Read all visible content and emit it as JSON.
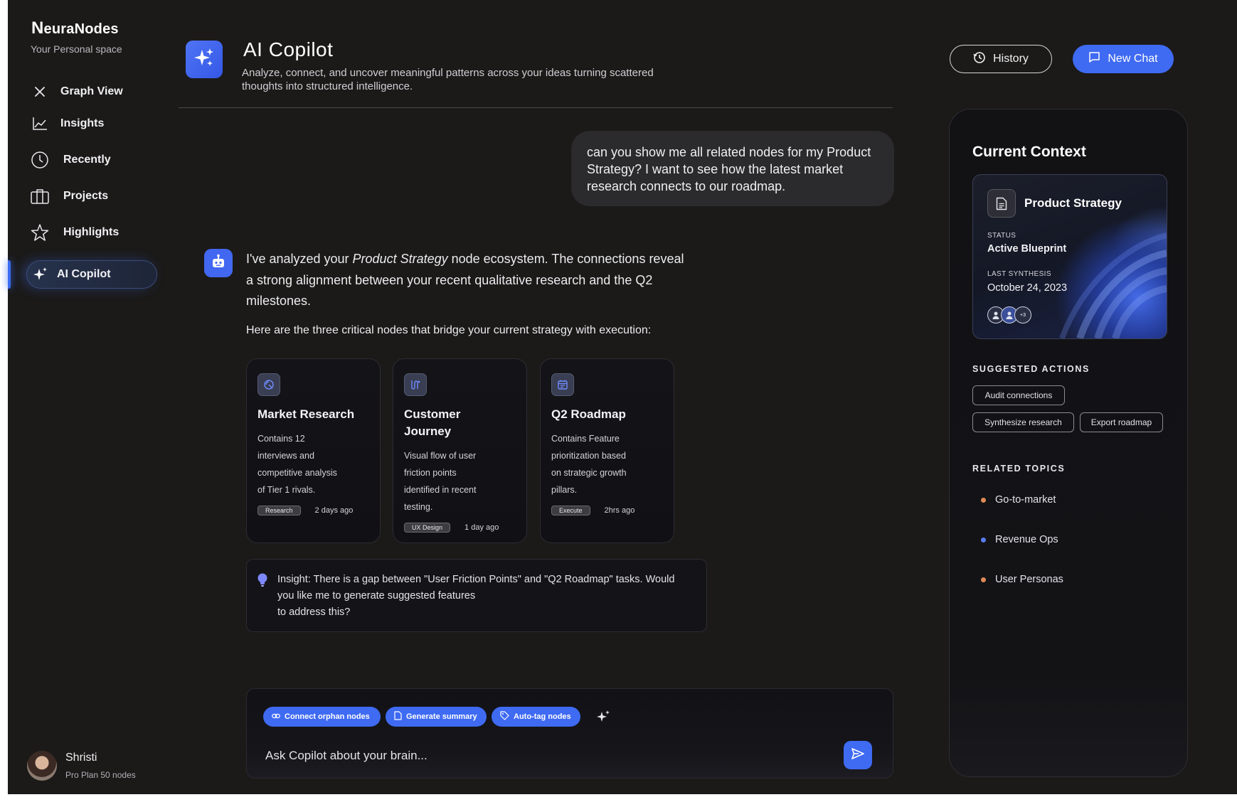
{
  "brand": {
    "logo_letter": "N",
    "logo_rest": "euraNodes",
    "subtitle": "Your Personal space"
  },
  "sidebar": {
    "items": [
      {
        "label": "Graph View",
        "icon": "graph-view-icon"
      },
      {
        "label": "Insights",
        "icon": "chart-line-icon"
      },
      {
        "label": "Recently",
        "icon": "clock-icon"
      },
      {
        "label": "Projects",
        "icon": "projects-icon"
      },
      {
        "label": "Highlights",
        "icon": "star-icon"
      },
      {
        "label": "AI Copilot",
        "icon": "sparkle-icon",
        "active": true
      }
    ]
  },
  "user": {
    "name": "Shristi",
    "plan": "Pro Plan 50 nodes"
  },
  "header": {
    "title": "AI Copilot",
    "description": "Analyze, connect, and uncover meaningful patterns across your ideas turning scattered thoughts into structured intelligence.",
    "history_label": "History",
    "new_chat_label": "New Chat"
  },
  "chat": {
    "user_message": "can you show me all related nodes for my Product Strategy? I want to see how the latest market research connects to our roadmap.",
    "bot_intro_before": "I've analyzed your ",
    "bot_intro_emph": "Product Strategy",
    "bot_intro_after": " node ecosystem. The connections reveal a strong alignment between your recent qualitative research and the Q2 milestones.",
    "bot_followup": "Here are the three critical nodes that bridge your current strategy with execution:",
    "nodes": [
      {
        "title": "Market Research",
        "description": "Contains 12 interviews and competitive analysis of Tier 1 rivals.",
        "tag": "Research",
        "time": "2 days ago",
        "icon": "market-research-icon"
      },
      {
        "title": "Customer Journey",
        "description": "Visual flow of user friction points identified in recent testing.",
        "tag": "UX Design",
        "time": "1 day ago",
        "icon": "journey-icon"
      },
      {
        "title": "Q2 Roadmap",
        "description": "Contains Feature prioritization based on strategic growth pillars.",
        "tag": "Execute",
        "time": "2hrs ago",
        "icon": "calendar-icon"
      }
    ],
    "insight_line1": "Insight: There is a gap between \"User Friction Points\" and \"Q2 Roadmap\" tasks. Would",
    "insight_line2": "you like me to generate suggested features",
    "insight_line3": "to address this?"
  },
  "composer": {
    "chips": [
      {
        "label": "Connect orphan nodes",
        "icon": "link-icon"
      },
      {
        "label": "Generate summary",
        "icon": "document-icon"
      },
      {
        "label": "Auto-tag nodes",
        "icon": "tag-icon"
      }
    ],
    "placeholder": "Ask Copilot about your brain..."
  },
  "context": {
    "title": "Current Context",
    "node_name": "Product Strategy",
    "status_label": "STATUS",
    "status_value": "Active Blueprint",
    "synthesis_label": "LAST SYNTHESIS",
    "synthesis_value": "October 24, 2023",
    "extra_collaborators": "+3",
    "suggested_title": "SUGGESTED ACTIONS",
    "actions": [
      "Audit connections",
      "Synthesize research",
      "Export roadmap"
    ],
    "related_title": "RELATED TOPICS",
    "topics": [
      {
        "label": "Go-to-market",
        "color": "#e08a55"
      },
      {
        "label": "Revenue Ops",
        "color": "#5a7cf0"
      },
      {
        "label": "User Personas",
        "color": "#e08a55"
      }
    ]
  },
  "colors": {
    "accent": "#3f6af2",
    "background": "#1b1a19",
    "card": "#141418"
  }
}
